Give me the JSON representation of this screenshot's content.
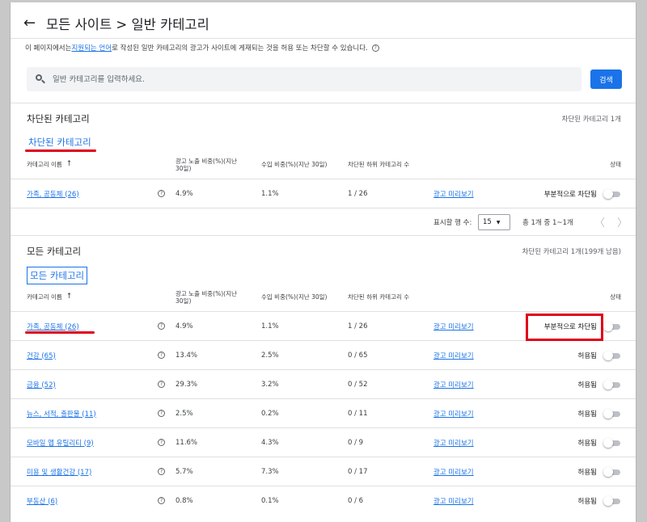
{
  "header": {
    "title": "모든 사이트 > 일반 카테고리"
  },
  "description": {
    "prefix": "이 페이지에서는 ",
    "link": "지원되는 언어",
    "suffix": "로 작성된 일반 카테고리의 광고가 사이트에 게재되는 것을 허용 또는 차단할 수 있습니다.",
    "help": "?"
  },
  "search": {
    "placeholder": "일반 카테고리를 입력하세요.",
    "button_label": "검색"
  },
  "table_headers": {
    "name": "카테고리 이름",
    "sort": "↑",
    "impressions_line1": "광고 노출 비중(%)(지난",
    "impressions_line2": "30일)",
    "revenue": "수입 비중(%)(지난 30일)",
    "subcategories": "차단된 하위 카테고리 수",
    "status": "상태"
  },
  "blocked_section": {
    "title": "차단된 카테고리",
    "count": "차단된 카테고리 1개",
    "tab_label": "차단된 카테고리",
    "rows": [
      {
        "name": "가족, 공동체 (26)",
        "impressions": "4.9%",
        "revenue": "1.1%",
        "subcats": "1 / 26",
        "preview": "광고 미리보기",
        "status": "부분적으로 차단됨"
      }
    ],
    "pagination": {
      "rows_label": "표시할 행 수:",
      "rows_value": "15",
      "range": "총 1개 중 1~1개"
    }
  },
  "all_section": {
    "title": "모든 카테고리",
    "count": "차단된 카테고리 1개(199개 남음)",
    "tab_label": "모든 카테고리",
    "rows": [
      {
        "name": "가족, 공동체 (26)",
        "impressions": "4.9%",
        "revenue": "1.1%",
        "subcats": "1 / 26",
        "preview": "광고 미리보기",
        "status": "부분적으로 차단됨"
      },
      {
        "name": "건강 (65)",
        "impressions": "13.4%",
        "revenue": "2.5%",
        "subcats": "0 / 65",
        "preview": "광고 미리보기",
        "status": "허용됨"
      },
      {
        "name": "금융 (52)",
        "impressions": "29.3%",
        "revenue": "3.2%",
        "subcats": "0 / 52",
        "preview": "광고 미리보기",
        "status": "허용됨"
      },
      {
        "name": "뉴스, 서적, 출판물 (11)",
        "impressions": "2.5%",
        "revenue": "0.2%",
        "subcats": "0 / 11",
        "preview": "광고 미리보기",
        "status": "허용됨"
      },
      {
        "name": "모바일 앱 유틸리티 (9)",
        "impressions": "11.6%",
        "revenue": "4.3%",
        "subcats": "0 / 9",
        "preview": "광고 미리보기",
        "status": "허용됨"
      },
      {
        "name": "미용 및 생활건강 (17)",
        "impressions": "5.7%",
        "revenue": "7.3%",
        "subcats": "0 / 17",
        "preview": "광고 미리보기",
        "status": "허용됨"
      },
      {
        "name": "부동산 (6)",
        "impressions": "0.8%",
        "revenue": "0.1%",
        "subcats": "0 / 6",
        "preview": "광고 미리보기",
        "status": "허용됨"
      }
    ]
  },
  "icons": {
    "back": "arrow-left-icon",
    "search": "search-icon",
    "help": "help-circle-icon",
    "toggle": "toggle-off"
  },
  "colors": {
    "accent": "#1a73e8",
    "annotation": "#e0001b"
  }
}
